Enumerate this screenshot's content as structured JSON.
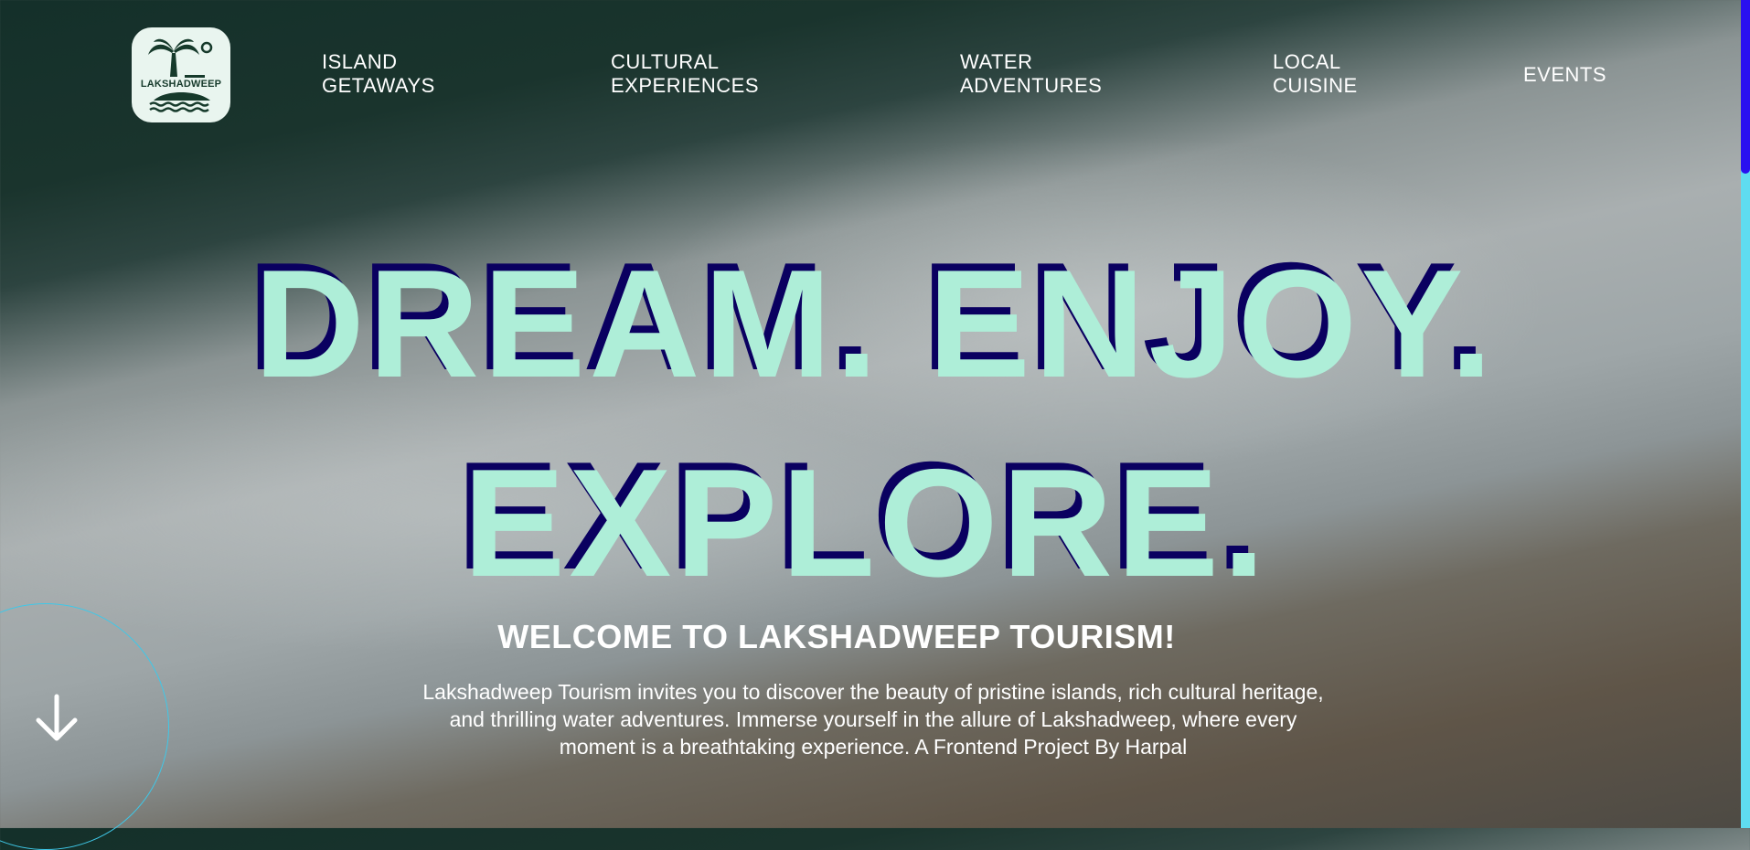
{
  "logo": {
    "text": "LAKSHADWEEP"
  },
  "nav": [
    {
      "line1": "ISLAND",
      "line2": "GETAWAYS"
    },
    {
      "line1": "CULTURAL",
      "line2": "EXPERIENCES"
    },
    {
      "line1": "WATER",
      "line2": "ADVENTURES"
    },
    {
      "line1": "LOCAL",
      "line2": "CUISINE"
    },
    {
      "line1": "EVENTS",
      "line2": ""
    }
  ],
  "hero": {
    "headline_line1": "DREAM. ENJOY.",
    "headline_line2": "EXPLORE.",
    "welcome": "WELCOME TO LAKSHADWEEP TOURISM!",
    "description": "Lakshadweep Tourism invites you to discover the beauty of pristine islands, rich cultural heritage, and thrilling water adventures. Immerse yourself in the allure of Lakshadweep, where every moment is a breathtaking experience. A Frontend Project By Harpal"
  },
  "colors": {
    "headline": "#aeeed8",
    "headline_shadow": "#0a0060",
    "scroll_thumb": "#2a10f0",
    "scroll_track": "#5fdcf0",
    "circle": "#3fc8e8"
  },
  "icons": {
    "scroll": "arrow-down-icon"
  }
}
